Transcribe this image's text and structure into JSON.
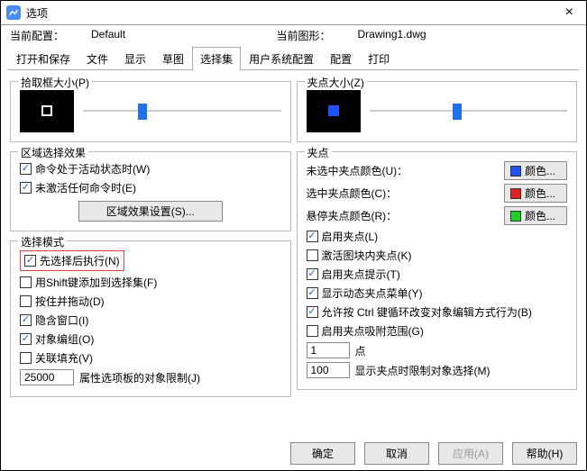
{
  "window": {
    "title": "选项"
  },
  "info": {
    "cfg_lbl": "当前配置：",
    "cfg_val": "Default",
    "draw_lbl": "当前图形：",
    "draw_val": "Drawing1.dwg"
  },
  "tabs": [
    "打开和保存",
    "文件",
    "显示",
    "草图",
    "选择集",
    "用户系统配置",
    "配置",
    "打印"
  ],
  "left": {
    "pickbox_title": "拾取框大小(P)",
    "region_title": "区域选择效果",
    "region_active": "命令处于活动状态时(W)",
    "region_noactive": "未激活任何命令时(E)",
    "region_btn": "区域效果设置(S)...",
    "mode_title": "选择模式",
    "mode_precedence": "先选择后执行(N)",
    "mode_shift": "用Shift键添加到选择集(F)",
    "mode_pressdrag": "按住并拖动(D)",
    "mode_implied": "隐含窗口(I)",
    "mode_group": "对象编组(O)",
    "mode_hatch": "关联填充(V)",
    "mode_limit_val": "25000",
    "mode_limit_lbl": "属性选项板的对象限制(J)"
  },
  "right": {
    "gripsize_title": "夹点大小(Z)",
    "grip_title": "夹点",
    "color_unsel": "未选中夹点颜色(U)：",
    "color_sel": "选中夹点颜色(C)：",
    "color_hover": "悬停夹点颜色(R)：",
    "color_btn": "颜色...",
    "swatch_unsel": "#2050ff",
    "swatch_sel": "#e02020",
    "swatch_hover": "#20d020",
    "grip_enable": "启用夹点(L)",
    "grip_block": "激活图块内夹点(K)",
    "grip_tips": "启用夹点提示(T)",
    "grip_dynmenu": "显示动态夹点菜单(Y)",
    "grip_ctrl": "允许按 Ctrl 键循环改变对象编辑方式行为(B)",
    "grip_snap": "启用夹点吸附范围(G)",
    "grip_snap_val": "1",
    "grip_snap_unit": "点",
    "grip_limit_val": "100",
    "grip_limit_lbl": "显示夹点时限制对象选择(M)"
  },
  "footer": {
    "ok": "确定",
    "cancel": "取消",
    "apply": "应用(A)",
    "help": "帮助(H)"
  }
}
